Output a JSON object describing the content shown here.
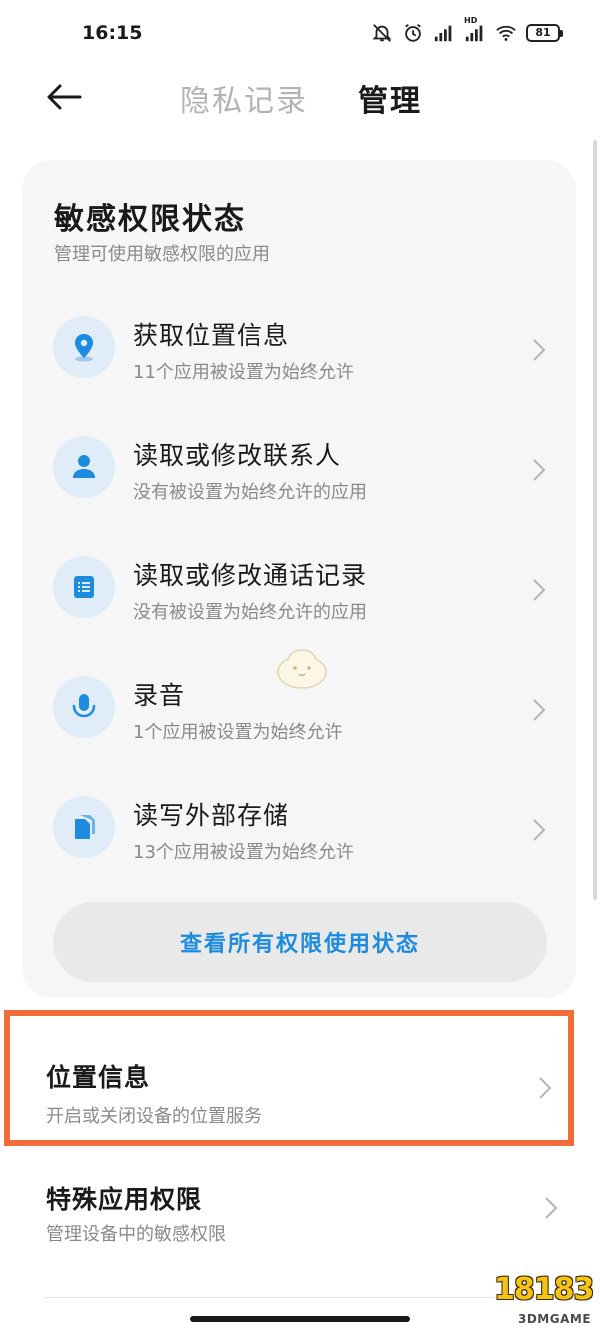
{
  "status_bar": {
    "time": "16:15",
    "battery": "81",
    "hd_label": "HD",
    "icons": [
      "mute-icon",
      "alarm-icon",
      "signal-icon",
      "hd-signal-icon",
      "wifi-icon",
      "battery-icon"
    ]
  },
  "nav": {
    "tabs": [
      {
        "label": "隐私记录",
        "active": false
      },
      {
        "label": "管理",
        "active": true
      }
    ]
  },
  "sensitive": {
    "title": "敏感权限状态",
    "subtitle": "管理可使用敏感权限的应用",
    "items": [
      {
        "title": "获取位置信息",
        "desc": "11个应用被设置为始终允许",
        "icon": "location-pin-icon"
      },
      {
        "title": "读取或修改联系人",
        "desc": "没有被设置为始终允许的应用",
        "icon": "person-icon"
      },
      {
        "title": "读取或修改通话记录",
        "desc": "没有被设置为始终允许的应用",
        "icon": "call-log-icon"
      },
      {
        "title": "录音",
        "desc": "1个应用被设置为始终允许",
        "icon": "microphone-icon"
      },
      {
        "title": "读写外部存储",
        "desc": "13个应用被设置为始终允许",
        "icon": "storage-icon"
      }
    ],
    "view_all_label": "查看所有权限使用状态"
  },
  "settings": {
    "location": {
      "title": "位置信息",
      "desc": "开启或关闭设备的位置服务"
    },
    "special": {
      "title": "特殊应用权限",
      "desc": "管理设备中的敏感权限"
    }
  },
  "watermark": {
    "logo": "18183",
    "site": "3DMGAME"
  },
  "colors": {
    "accent": "#1d8ce0",
    "icon_bg": "#e0ecf7",
    "highlight_border": "#f26b3a",
    "card_bg": "#f6f6f6"
  }
}
